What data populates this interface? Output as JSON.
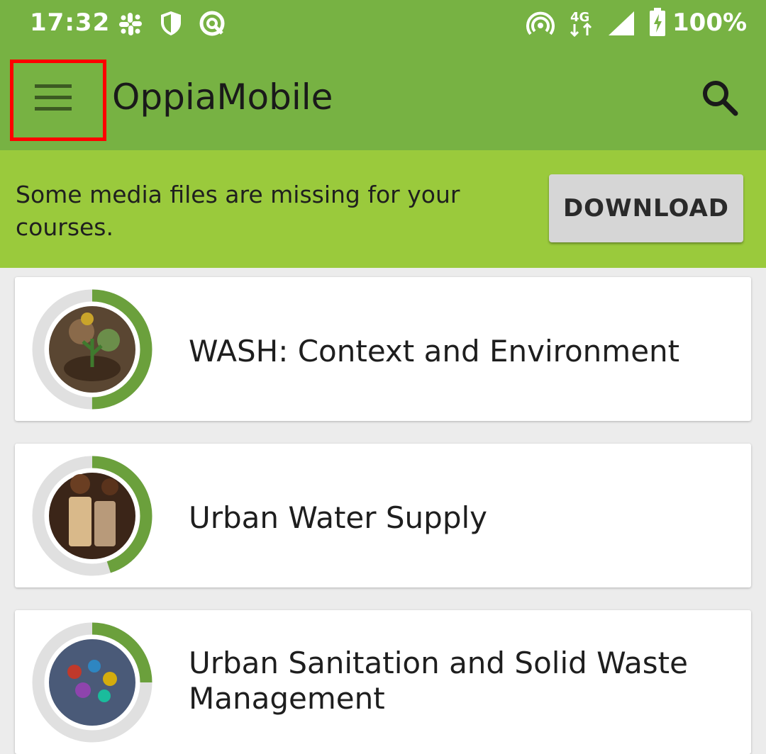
{
  "status_bar": {
    "time": "17:32",
    "battery_percent": "100%",
    "network_type": "4G",
    "icons": [
      "slack-icon",
      "shield-icon",
      "vpn-icon",
      "hotspot-icon",
      "4g-icon",
      "signal-icon",
      "battery-charging-icon"
    ]
  },
  "app_bar": {
    "title": "OppiaMobile",
    "menu_icon": "hamburger-menu-icon",
    "search_icon": "search-icon"
  },
  "banner": {
    "message": "Some media files are missing for your courses.",
    "button_label": "DOWNLOAD"
  },
  "courses": [
    {
      "title": "WASH: Context and Environment",
      "progress": 0.5
    },
    {
      "title": "Urban Water Supply",
      "progress": 0.45
    },
    {
      "title": "Urban Sanitation and Solid Waste Management",
      "progress": 0.25
    }
  ],
  "colors": {
    "app_bar": "#77b243",
    "banner": "#9aca3c",
    "progress": "#6ba03c",
    "progress_track": "#e0e0e0",
    "highlight": "#ff0000"
  }
}
